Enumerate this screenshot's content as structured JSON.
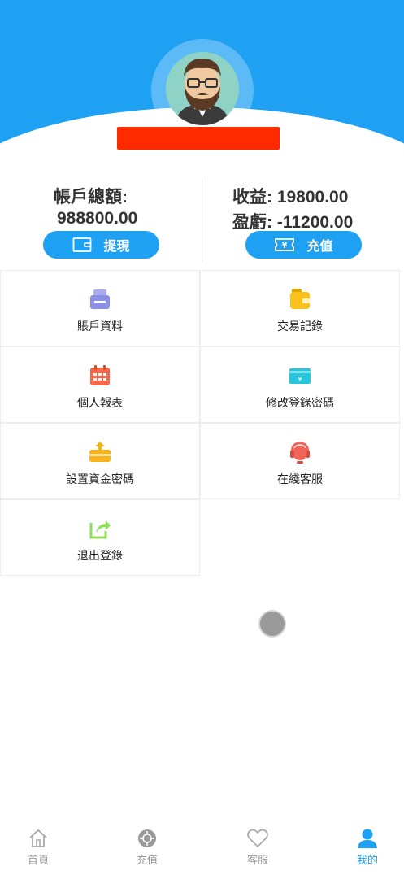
{
  "balance": {
    "label": "帳戶總額:",
    "value": "988800.00",
    "withdraw_label": "提現"
  },
  "profit": {
    "income_text": "收益:  19800.00",
    "pnl_text": "盈虧:  -11200.00",
    "recharge_label": "充值"
  },
  "menu": [
    {
      "label": "賬戶資料",
      "icon": "account-info-icon",
      "color": "#8b8fe6"
    },
    {
      "label": "交易記錄",
      "icon": "wallet-icon",
      "color": "#f8c21a"
    },
    {
      "label": "個人報表",
      "icon": "calendar-icon",
      "color": "#f5694a"
    },
    {
      "label": "修改登錄密碼",
      "icon": "card-icon",
      "color": "#27c6dc"
    },
    {
      "label": "設置資金密碼",
      "icon": "fund-icon",
      "color": "#f8b41a"
    },
    {
      "label": "在綫客服",
      "icon": "headset-icon",
      "color": "#f0645a"
    },
    {
      "label": "退出登錄",
      "icon": "logout-icon",
      "color": "#8ee05a"
    }
  ],
  "tabs": [
    {
      "label": "首頁",
      "icon": "home-icon"
    },
    {
      "label": "充值",
      "icon": "recharge-icon"
    },
    {
      "label": "客服",
      "icon": "heart-icon"
    },
    {
      "label": "我的",
      "icon": "user-icon",
      "active": true
    }
  ],
  "colors": {
    "accent": "#1ea0f3",
    "redaction": "#ff2a00"
  }
}
